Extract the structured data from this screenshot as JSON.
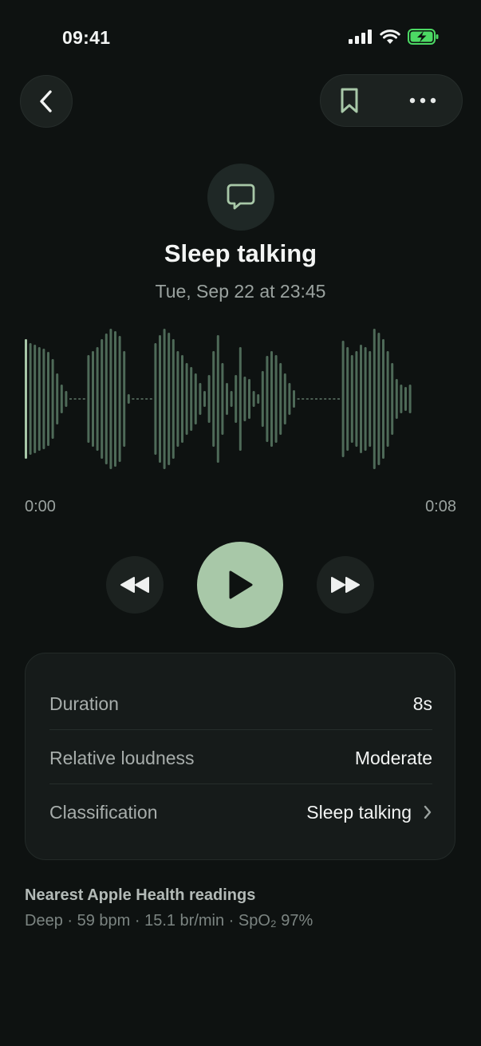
{
  "status_bar": {
    "time": "09:41",
    "signal_icon": "cellular-signal-icon",
    "wifi_icon": "wifi-icon",
    "battery_icon": "battery-charging-icon",
    "battery_color": "#4cd964"
  },
  "nav": {
    "back_icon": "chevron-left-icon",
    "bookmark_icon": "bookmark-icon",
    "more_icon": "more-horizontal-icon"
  },
  "event": {
    "icon": "speech-bubble-icon",
    "title": "Sleep talking",
    "date": "Tue, Sep 22 at 23:45"
  },
  "player": {
    "time_start": "0:00",
    "time_end": "0:08",
    "progress": 0.0,
    "rewind_icon": "rewind-icon",
    "play_icon": "play-icon",
    "forward_icon": "fast-forward-icon",
    "accent_color": "#a8c8a8"
  },
  "details": {
    "duration_label": "Duration",
    "duration_value": "8s",
    "loudness_label": "Relative loudness",
    "loudness_value": "Moderate",
    "classification_label": "Classification",
    "classification_value": "Sleep talking"
  },
  "health": {
    "title": "Nearest Apple Health readings",
    "readings": "Deep · 59 bpm · 15.1 br/min · SpO₂ 97%"
  }
}
